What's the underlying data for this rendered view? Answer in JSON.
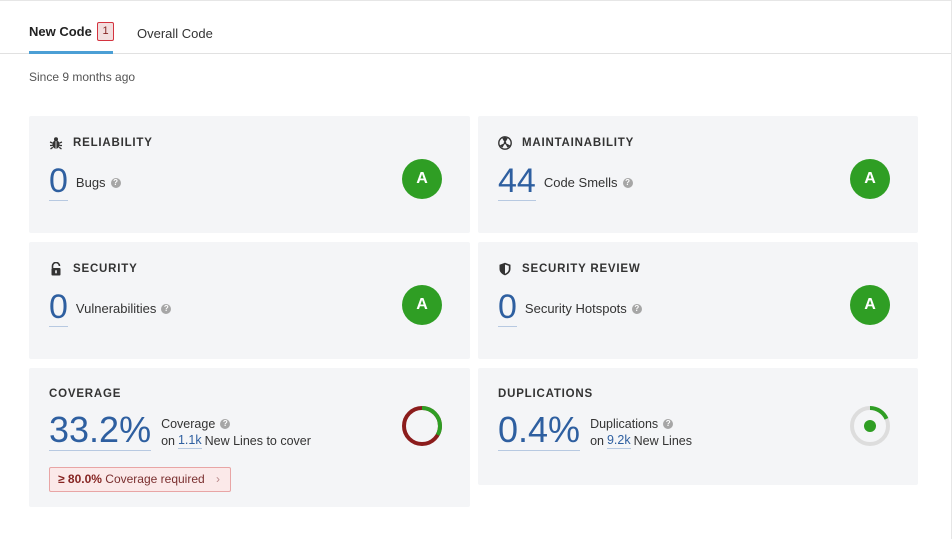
{
  "tabs": {
    "new_code": {
      "label": "New Code",
      "badge": "1"
    },
    "overall_code": {
      "label": "Overall Code"
    }
  },
  "since_text": "Since 9 months ago",
  "cards": {
    "reliability": {
      "title": "RELIABILITY",
      "value": "0",
      "label": "Bugs",
      "rating": "A",
      "icon": "bug-icon"
    },
    "maintainability": {
      "title": "MAINTAINABILITY",
      "value": "44",
      "label": "Code Smells",
      "rating": "A",
      "icon": "radiation-icon"
    },
    "security": {
      "title": "SECURITY",
      "value": "0",
      "label": "Vulnerabilities",
      "rating": "A",
      "icon": "lock-icon"
    },
    "security_review": {
      "title": "SECURITY REVIEW",
      "value": "0",
      "label": "Security Hotspots",
      "rating": "A",
      "icon": "shield-icon"
    },
    "coverage": {
      "title": "COVERAGE",
      "value": "33.2%",
      "label": "Coverage",
      "on": "on",
      "lines_count": "1.1k",
      "lines_text": "New Lines to cover",
      "requirement_value": "≥ 80.0%",
      "requirement_text": "Coverage required",
      "percent": 33.2
    },
    "duplications": {
      "title": "DUPLICATIONS",
      "value": "0.4%",
      "label": "Duplications",
      "on": "on",
      "lines_count": "9.2k",
      "lines_text": "New Lines",
      "percent": 0.4
    }
  },
  "help_glyph": "?",
  "colors": {
    "accent": "#4b9fd5",
    "rating_a": "#2f9e24",
    "link": "#2e5fa0",
    "coverage_bad": "#8b1c1c",
    "coverage_good": "#2f9e24"
  }
}
